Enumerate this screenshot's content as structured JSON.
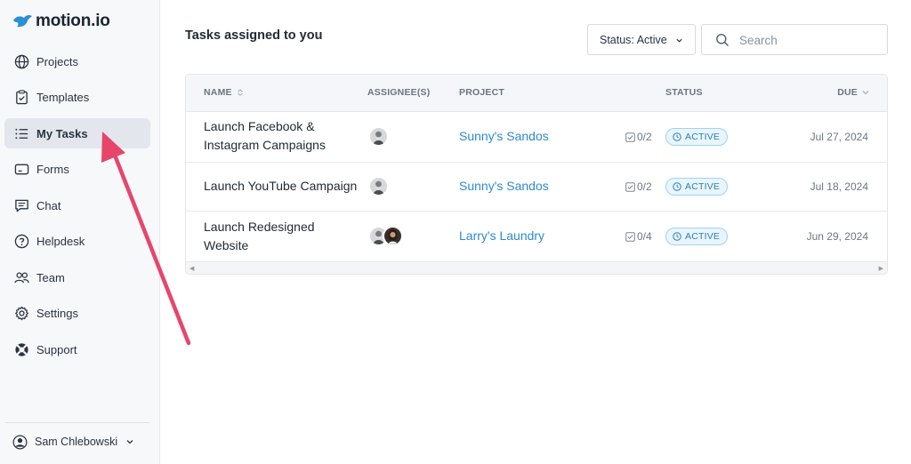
{
  "app": {
    "name": "motion.io"
  },
  "sidebar": {
    "items": [
      {
        "label": "Projects",
        "icon": "globe-icon"
      },
      {
        "label": "Templates",
        "icon": "clipboard-check-icon"
      },
      {
        "label": "My Tasks",
        "icon": "list-icon",
        "active": true
      },
      {
        "label": "Forms",
        "icon": "form-icon"
      },
      {
        "label": "Chat",
        "icon": "chat-icon"
      },
      {
        "label": "Helpdesk",
        "icon": "help-circle-icon"
      },
      {
        "label": "Team",
        "icon": "team-icon"
      },
      {
        "label": "Settings",
        "icon": "gear-icon"
      },
      {
        "label": "Support",
        "icon": "lifebuoy-icon"
      }
    ],
    "user": {
      "name": "Sam Chlebowski"
    }
  },
  "main": {
    "title": "Tasks assigned to you",
    "status_filter": "Status: Active",
    "search_placeholder": "Search",
    "columns": {
      "name": "NAME",
      "assignees": "ASSIGNEE(S)",
      "project": "PROJECT",
      "status": "STATUS",
      "due": "DUE"
    },
    "rows": [
      {
        "name": "Launch Facebook & Instagram Campaigns",
        "project": "Sunny's Sandos",
        "checklist": "0/2",
        "status": "ACTIVE",
        "due": "Jul 27, 2024"
      },
      {
        "name": "Launch YouTube Campaign",
        "project": "Sunny's Sandos",
        "checklist": "0/2",
        "status": "ACTIVE",
        "due": "Jul 18, 2024"
      },
      {
        "name": "Launch Redesigned Website",
        "project": "Larry's Laundry",
        "checklist": "0/4",
        "status": "ACTIVE",
        "due": "Jun 29, 2024"
      }
    ]
  },
  "colors": {
    "accent_link": "#2d8ad1",
    "annotation_arrow": "#e8456b",
    "status_badge": "#2a7fb8"
  }
}
